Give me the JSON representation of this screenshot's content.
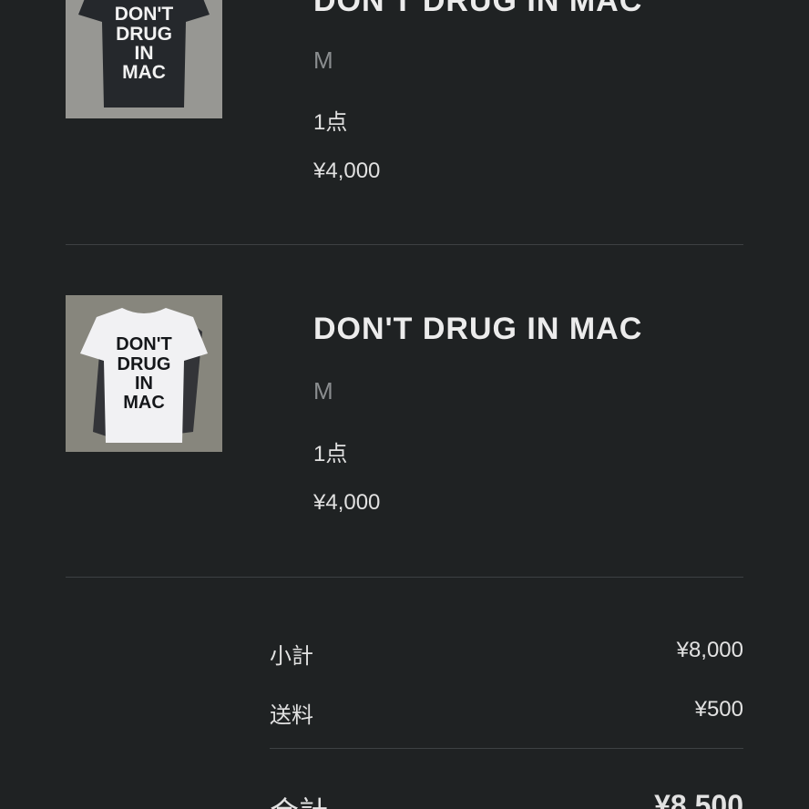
{
  "items": [
    {
      "title": "DON'T DRUG IN MAC",
      "variant": "M",
      "quantity": "1点",
      "price": "¥4,000",
      "shirt_color": "#25282c",
      "print_color": "#f2f2f2",
      "shirt_text": [
        "DON'T",
        "DRUG",
        "IN",
        "MAC"
      ]
    },
    {
      "title": "DON'T DRUG IN MAC",
      "variant": "M",
      "quantity": "1点",
      "price": "¥4,000",
      "shirt_color": "#f1f1f3",
      "print_color": "#15171a",
      "shirt_text": [
        "DON'T",
        "DRUG",
        "IN",
        "MAC"
      ]
    }
  ],
  "summary": {
    "subtotal_label": "小計",
    "subtotal_value": "¥8,000",
    "shipping_label": "送料",
    "shipping_value": "¥500",
    "total_label": "合計",
    "total_value": "¥8,500"
  },
  "colors": {
    "background": "#1f2223",
    "divider": "#3d4143",
    "muted_text": "#8a8d8f"
  }
}
